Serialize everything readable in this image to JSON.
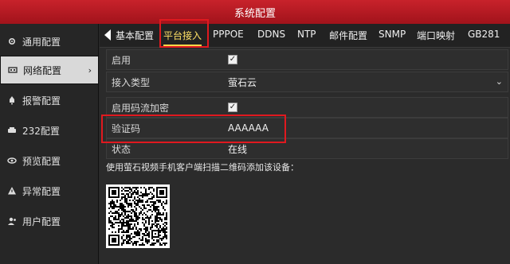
{
  "title": "系统配置",
  "sidebar": {
    "items": [
      {
        "label": "通用配置",
        "icon": "gear-icon"
      },
      {
        "label": "网络配置",
        "icon": "network-icon",
        "active": true
      },
      {
        "label": "报警配置",
        "icon": "bell-icon"
      },
      {
        "label": "232配置",
        "icon": "serial-icon"
      },
      {
        "label": "预览配置",
        "icon": "eye-icon"
      },
      {
        "label": "异常配置",
        "icon": "warning-icon"
      },
      {
        "label": "用户配置",
        "icon": "user-icon"
      }
    ],
    "active_chevron": "›"
  },
  "tabs": [
    {
      "label": "基本配置"
    },
    {
      "label": "平台接入",
      "active": true
    },
    {
      "label": "PPPOE"
    },
    {
      "label": "DDNS"
    },
    {
      "label": "NTP"
    },
    {
      "label": "邮件配置"
    },
    {
      "label": "SNMP"
    },
    {
      "label": "端口映射"
    },
    {
      "label": "GB281"
    }
  ],
  "form": {
    "enable_label": "启用",
    "enable_checked": "✓",
    "access_type_label": "接入类型",
    "access_type_value": "萤石云",
    "stream_encrypt_label": "启用码流加密",
    "stream_encrypt_checked": "✓",
    "verify_code_label": "验证码",
    "verify_code_value": "AAAAAA",
    "status_label": "状态",
    "status_value": "在线"
  },
  "hint_text": "使用萤石视频手机客户端扫描二维码添加该设备：",
  "colors": {
    "title_bar": "#b81a22",
    "highlight": "#e0191f",
    "active_tab": "#ffe066"
  }
}
